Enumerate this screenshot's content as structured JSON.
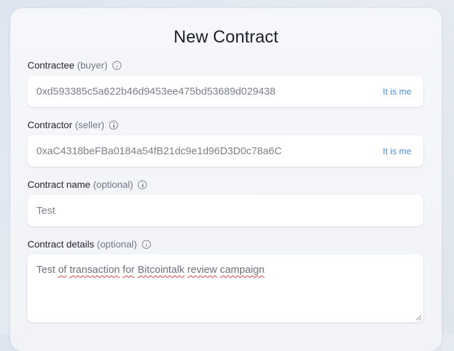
{
  "form": {
    "title": "New Contract",
    "contractee": {
      "label": "Contractee",
      "hint": "(buyer)",
      "value": "0xd593385c5a622b46d9453ee475bd53689d029438",
      "action": "It is me"
    },
    "contractor": {
      "label": "Contractor",
      "hint": "(seller)",
      "value": "0xaC4318beFBa0184a54fB21dc9e1d96D3D0c78a6C",
      "action": "It is me"
    },
    "name": {
      "label": "Contract name",
      "hint": "(optional)",
      "value": "Test"
    },
    "details": {
      "label": "Contract details",
      "hint": "(optional)",
      "value_parts": [
        "Test ",
        "of",
        " ",
        "transaction",
        " ",
        "for",
        " ",
        "Bitcointalk",
        " ",
        "review",
        " ",
        "campaign"
      ]
    }
  },
  "colors": {
    "accent": "#4a8fe0",
    "spellcheck": "#e0393e"
  }
}
